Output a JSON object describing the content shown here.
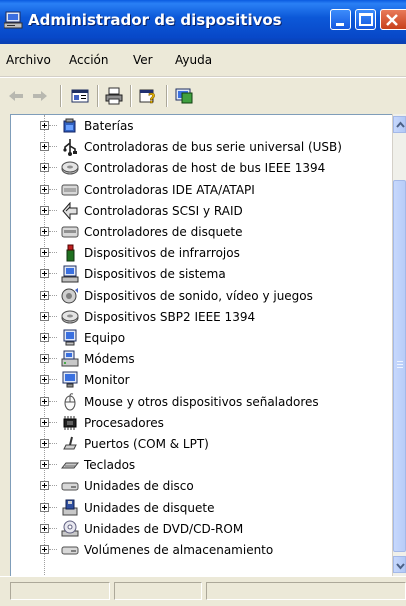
{
  "window": {
    "title": "Administrador de dispositivos"
  },
  "menu": [
    "Archivo",
    "Acción",
    "Ver",
    "Ayuda"
  ],
  "toolbar": {
    "icons": [
      "back-arrow-icon",
      "forward-arrow-icon",
      "properties-icon",
      "print-icon",
      "help-icon",
      "scan-hardware-icon"
    ]
  },
  "tree": {
    "items": [
      {
        "label": "Baterías",
        "icon": "battery-icon"
      },
      {
        "label": "Controladoras de bus serie universal (USB)",
        "icon": "usb-icon"
      },
      {
        "label": "Controladoras de host de bus IEEE 1394",
        "icon": "ieee1394-icon"
      },
      {
        "label": "Controladoras IDE ATA/ATAPI",
        "icon": "ide-controller-icon"
      },
      {
        "label": "Controladoras SCSI y RAID",
        "icon": "scsi-icon"
      },
      {
        "label": "Controladores de disquete",
        "icon": "floppy-controller-icon"
      },
      {
        "label": "Dispositivos de infrarrojos",
        "icon": "infrared-icon"
      },
      {
        "label": "Dispositivos de sistema",
        "icon": "system-device-icon"
      },
      {
        "label": "Dispositivos de sonido, vídeo y juegos",
        "icon": "sound-icon"
      },
      {
        "label": "Dispositivos SBP2 IEEE 1394",
        "icon": "sbp2-icon"
      },
      {
        "label": "Equipo",
        "icon": "computer-icon"
      },
      {
        "label": "Módems",
        "icon": "modem-icon"
      },
      {
        "label": "Monitor",
        "icon": "monitor-icon"
      },
      {
        "label": "Mouse y otros dispositivos señaladores",
        "icon": "mouse-icon"
      },
      {
        "label": "Procesadores",
        "icon": "processor-icon"
      },
      {
        "label": "Puertos (COM & LPT)",
        "icon": "port-icon"
      },
      {
        "label": "Teclados",
        "icon": "keyboard-icon"
      },
      {
        "label": "Unidades de disco",
        "icon": "disk-drive-icon"
      },
      {
        "label": "Unidades de disquete",
        "icon": "floppy-drive-icon"
      },
      {
        "label": "Unidades de DVD/CD-ROM",
        "icon": "dvd-icon"
      },
      {
        "label": "Volúmenes de almacenamiento",
        "icon": "storage-volume-icon"
      }
    ]
  },
  "colors": {
    "titlebar": "#0a5be0",
    "window_bg": "#ece9d8"
  }
}
